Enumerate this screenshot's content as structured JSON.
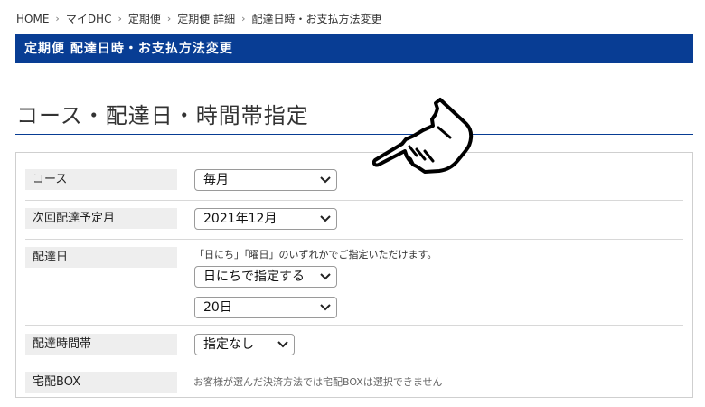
{
  "breadcrumb": {
    "items": [
      "HOME",
      "マイDHC",
      "定期便",
      "定期便 詳細"
    ],
    "current": "配達日時・お支払方法変更",
    "separator": "›"
  },
  "header": {
    "title": "定期便 配達日時・お支払方法変更"
  },
  "section": {
    "title": "コース・配達日・時間帯指定"
  },
  "form": {
    "course": {
      "label": "コース",
      "value": "毎月"
    },
    "next_month": {
      "label": "次回配達予定月",
      "value": "2021年12月"
    },
    "delivery_day": {
      "label": "配達日",
      "note": "「日にち」「曜日」のいずれかでご指定いただけます。",
      "mode_value": "日にちで指定する",
      "day_value": "20日"
    },
    "time_slot": {
      "label": "配達時間帯",
      "value": "指定なし"
    },
    "box": {
      "label": "宅配BOX",
      "note": "お客様が選んだ決済方法では宅配BOXは選択できません"
    }
  },
  "colors": {
    "brand": "#083d94",
    "label_bg": "#eeeeee"
  },
  "icons": {
    "pointer": "pointing-hand-icon",
    "select": "chevron-down-icon"
  }
}
